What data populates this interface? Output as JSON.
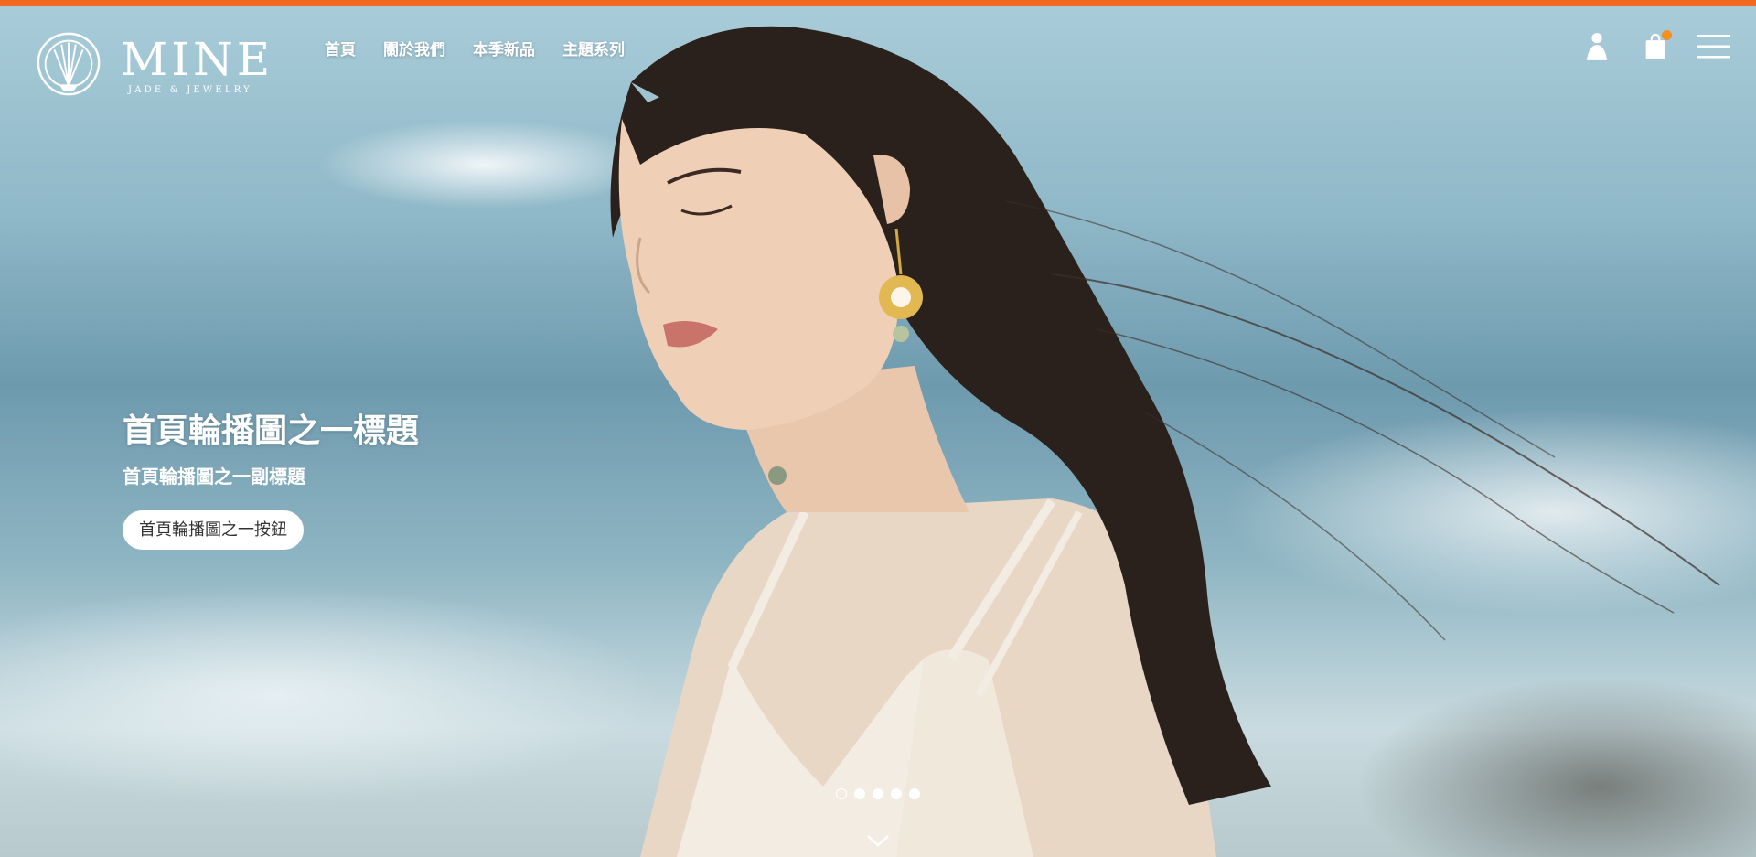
{
  "brand": {
    "name": "MINE",
    "tagline": "JADE & JEWELRY",
    "accent_color": "#f26a21"
  },
  "nav": {
    "items": [
      {
        "label": "首頁"
      },
      {
        "label": "關於我們"
      },
      {
        "label": "本季新品"
      },
      {
        "label": "主題系列"
      }
    ]
  },
  "header_icons": {
    "account": "user-icon",
    "cart": "shopping-bag-icon",
    "cart_badge_color": "#f5901e",
    "menu": "hamburger-menu-icon"
  },
  "slide": {
    "title": "首頁輪播圖之一標題",
    "subtitle": "首頁輪播圖之一副標題",
    "button_label": "首頁輪播圖之一按鈕",
    "image_description": "woman with long dark hair wearing gold flower earrings and white camisole by the sea"
  },
  "carousel": {
    "slide_count": 5,
    "active_index": 0
  },
  "scroll_indicator": "chevron-down-icon"
}
